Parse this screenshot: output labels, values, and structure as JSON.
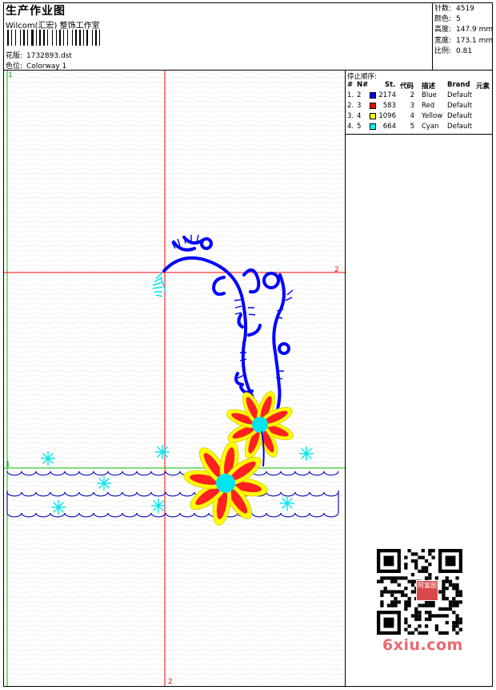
{
  "header": {
    "title": "生产作业图",
    "company": "Wilcom(汇宏) 整饰工作室",
    "design_label": "花版:",
    "design_value": "1732893.dst",
    "colorway_label": "色位:",
    "colorway_value": "Colorway 1"
  },
  "stats": [
    {
      "label": "针数:",
      "value": "4519"
    },
    {
      "label": "颜色:",
      "value": "5"
    },
    {
      "label": "高度:",
      "value": "147.9 mm"
    },
    {
      "label": "宽度:",
      "value": "173.1 mm"
    },
    {
      "label": "比例:",
      "value": "0.81"
    }
  ],
  "stop_sequence": {
    "title": "停止顺序:",
    "headers": [
      "#",
      "N#",
      "St.",
      "代码",
      "描述",
      "Brand",
      "元素"
    ],
    "rows": [
      {
        "idx": "1.",
        "n": "2",
        "st": "2174",
        "code": "2",
        "desc": "Blue",
        "brand": "Default",
        "color": "#0000ff"
      },
      {
        "idx": "2.",
        "n": "3",
        "st": "583",
        "code": "3",
        "desc": "Red",
        "brand": "Default",
        "color": "#ff0000"
      },
      {
        "idx": "3.",
        "n": "4",
        "st": "1096",
        "code": "4",
        "desc": "Yellow",
        "brand": "Default",
        "color": "#ffff00"
      },
      {
        "idx": "4.",
        "n": "5",
        "st": "664",
        "code": "5",
        "desc": "Cyan",
        "brand": "Default",
        "color": "#00ffff"
      }
    ]
  },
  "canvas_marks": {
    "top_left": "1",
    "right_h": "2",
    "bottom_v": "2",
    "left_h": "1"
  },
  "qr_badge": "阿富图",
  "watermark": "6xiu.com",
  "colors": {
    "blue": "#0000ff",
    "red": "#ff0000",
    "yellow": "#ffff00",
    "cyan": "#00e5ee",
    "guide_red": "#ff0000",
    "guide_green": "#00c000"
  }
}
